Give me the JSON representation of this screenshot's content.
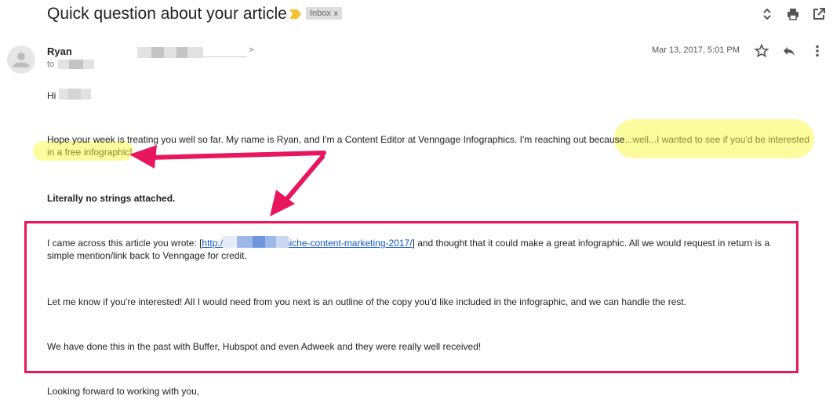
{
  "header": {
    "subject": "Quick question about your article",
    "label_chip": "Inbox",
    "label_chip_close": "x",
    "icons": [
      "expand-collapse-icon",
      "print-icon",
      "open-new-window-icon"
    ]
  },
  "message": {
    "sender_name": "Ryan",
    "sender_address_tail": ">",
    "to_prefix": "to",
    "date": "Mar 13, 2017, 5:01 PM",
    "row_icons": [
      "star-icon",
      "reply-icon",
      "more-vert-icon"
    ]
  },
  "body": {
    "greeting": "Hi",
    "para1_normal": "Hope your week is treating you well so far. My name is Ryan, and I'm a Content Editor at Venngage Infographics. I'm reaching out because",
    "para1_highlight": "...well...I wanted to see if you'd be interested in a free infographic!",
    "bold_line": "Literally no strings attached.",
    "para2_before": "I came across this article you wrote: [",
    "link_start": "http://",
    "link_end": "/niche-content-marketing-2017/",
    "para2_after": "] and thought that it could make a great infographic. All we would request in return is a simple mention/link back to Venngage for credit.",
    "para3": "Let me know if you're interested! All I would need from you next is an outline of the copy you'd like included in the infographic, and we can handle the rest.",
    "para4": "We have done this in the past with Buffer, Hubspot and even Adweek and they were really well received!",
    "closing": "Looking forward to working with you,"
  },
  "annotation": {
    "highlight_color": "#fbfb8e",
    "arrow_color": "#e8175d",
    "box_color": "#e8175d"
  }
}
